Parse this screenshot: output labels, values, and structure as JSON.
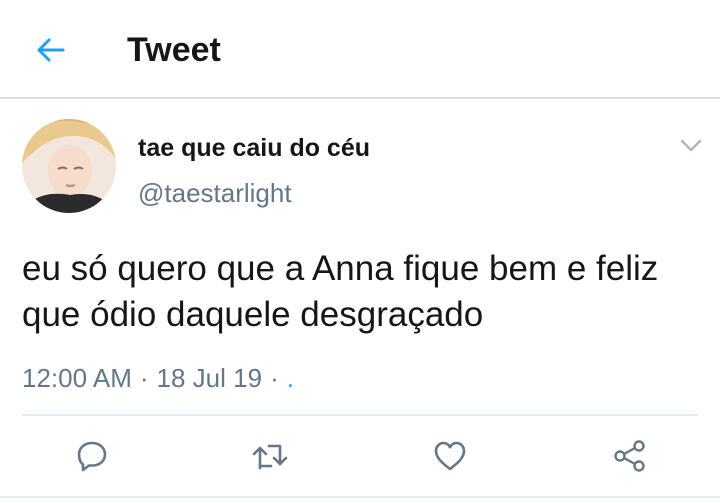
{
  "header": {
    "back_icon": "arrow-left-icon",
    "title": "Tweet",
    "accent_color": "#1da1f2"
  },
  "tweet": {
    "display_name": "tae que caiu do céu",
    "handle": "@taestarlight",
    "text": "eu só quero que a Anna fique bem e feliz que ódio daquele desgraçado",
    "time": "12:00 AM",
    "date": "18 Jul 19",
    "source": ".",
    "separator": "·",
    "menu_icon": "chevron-down-icon"
  },
  "actions": [
    {
      "icon": "reply-icon"
    },
    {
      "icon": "retweet-icon"
    },
    {
      "icon": "like-icon"
    },
    {
      "icon": "share-icon"
    }
  ]
}
